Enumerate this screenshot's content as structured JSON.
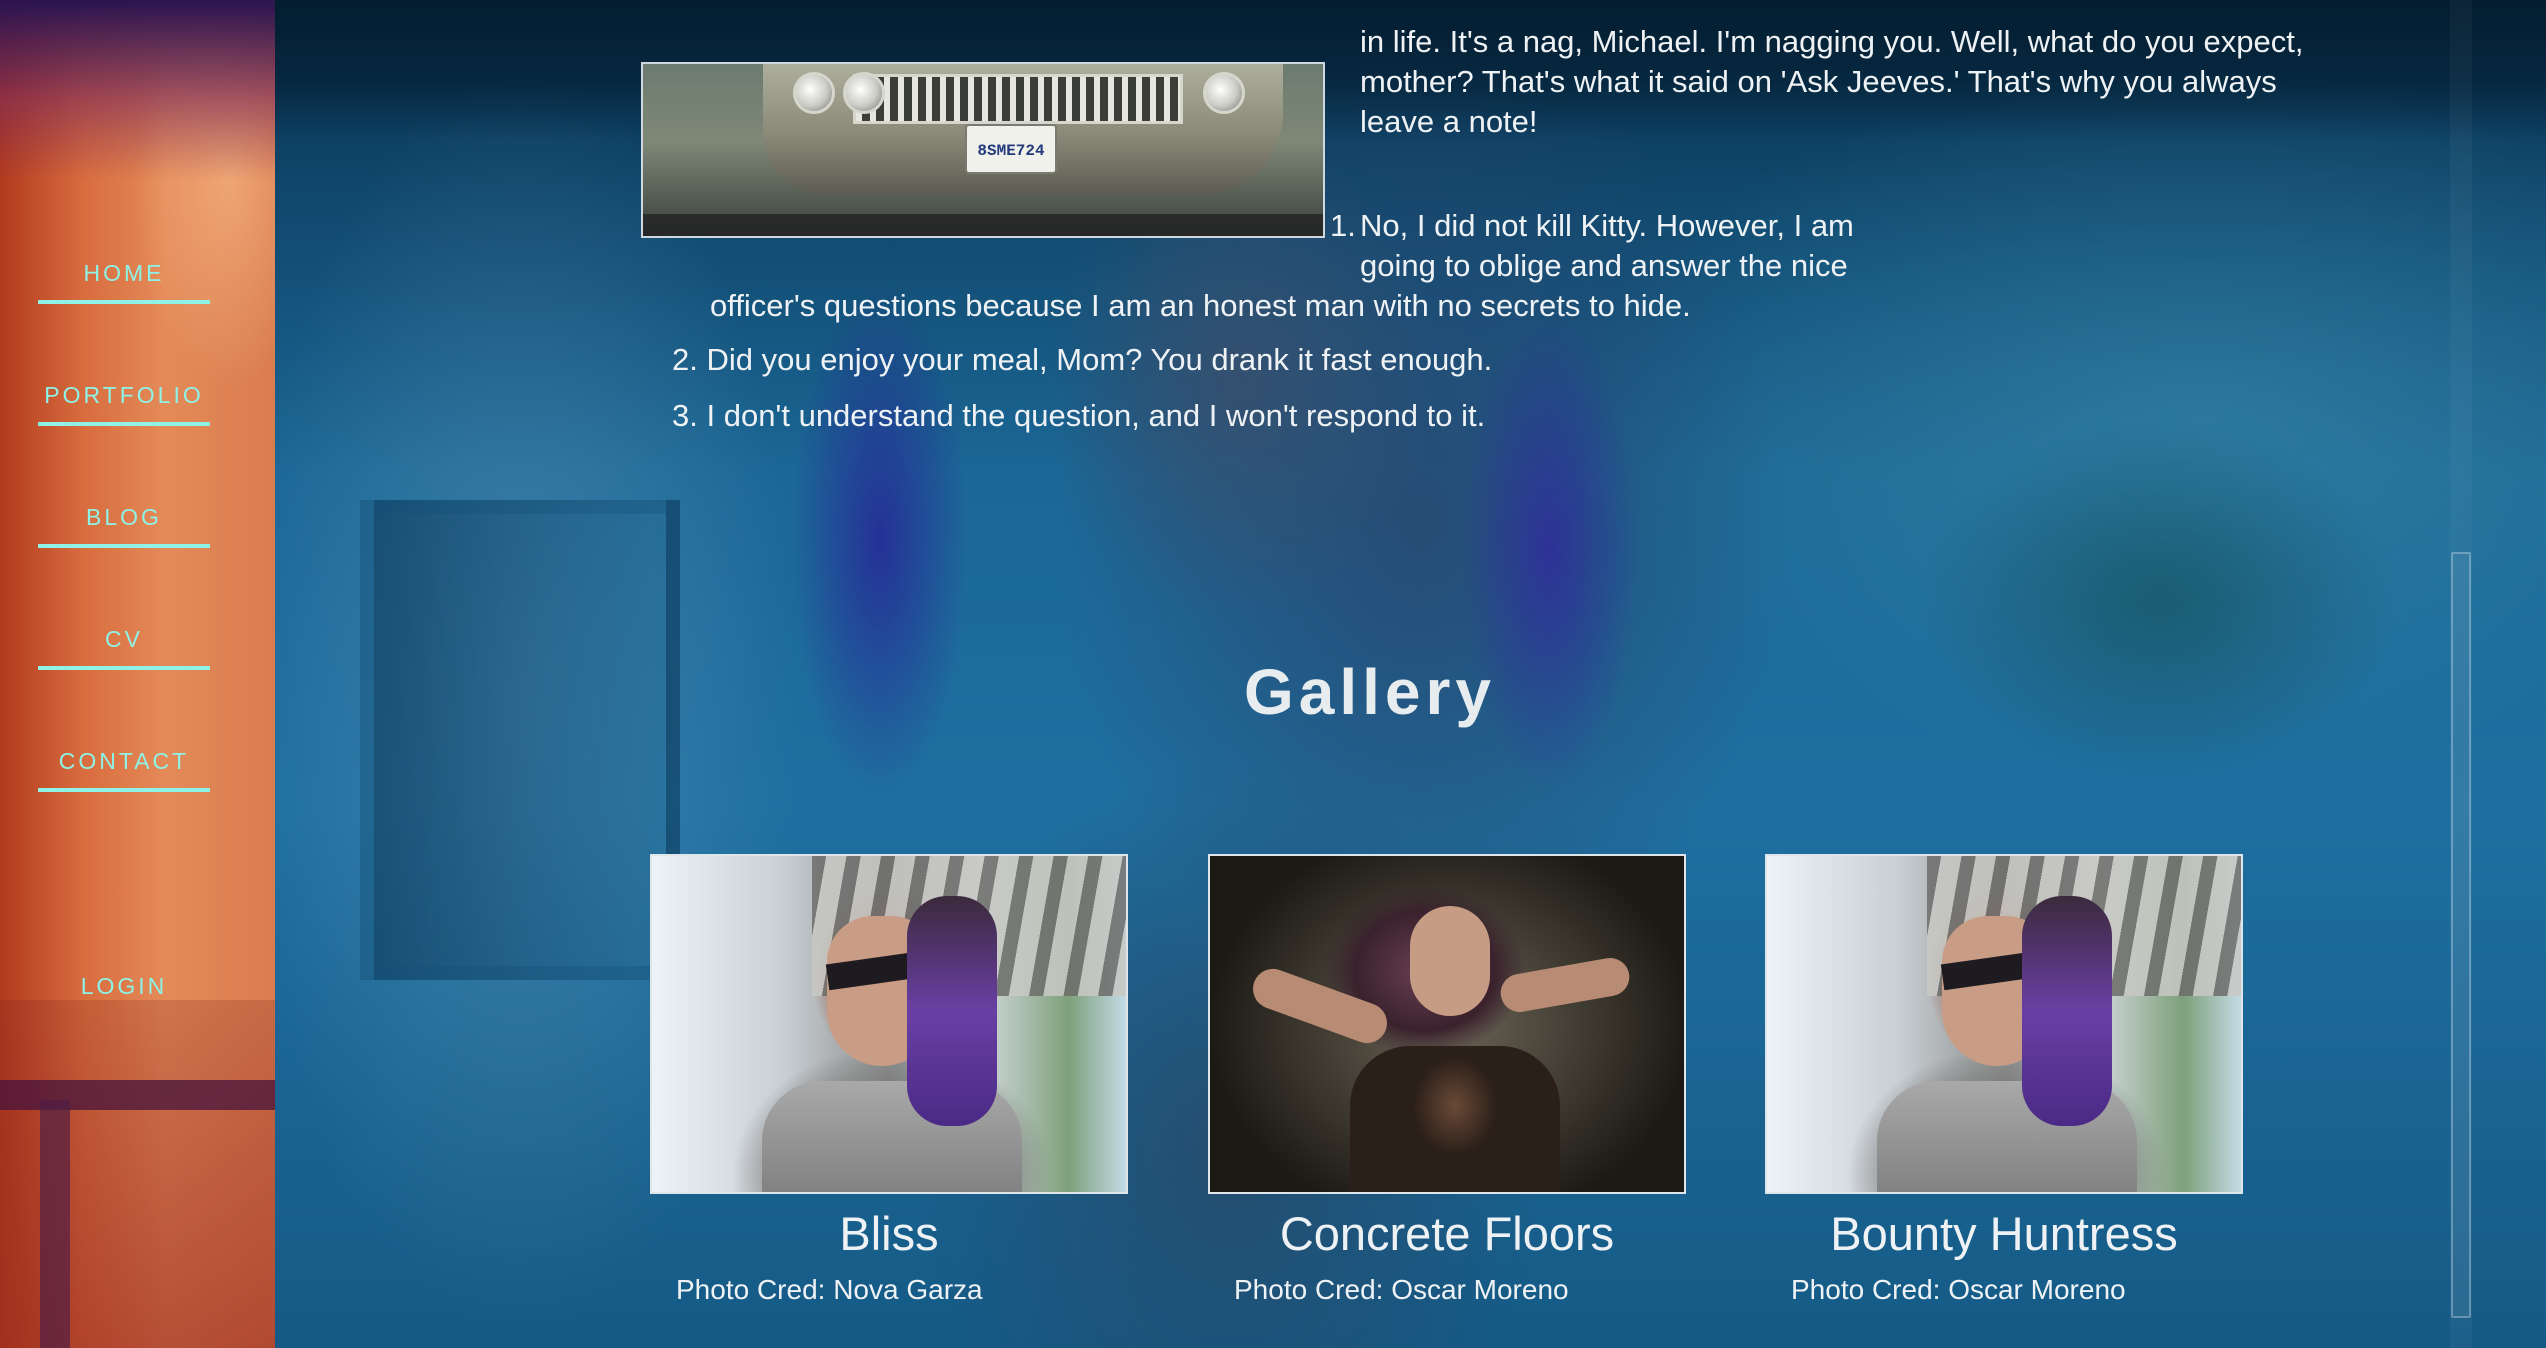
{
  "nav": {
    "items": [
      {
        "label": "HOME"
      },
      {
        "label": "PORTFOLIO"
      },
      {
        "label": "BLOG"
      },
      {
        "label": "CV"
      },
      {
        "label": "CONTACT"
      }
    ],
    "login": "LOGIN"
  },
  "article": {
    "car_plate": "8SME724",
    "paragraph_lines": [
      "in life. It's a nag, Michael. I'm nagging you. Well, what do you expect,",
      "mother? That's what it said on 'Ask Jeeves.' That's why you always",
      "leave a note!"
    ],
    "list": [
      {
        "number": "1.",
        "lines": [
          "No, I did not kill Kitty. However, I am",
          "going to oblige and answer the nice",
          "officer's questions because I am an honest man with no secrets to hide."
        ]
      },
      {
        "number": "2.",
        "text": "Did you enjoy your meal, Mom? You drank it fast enough."
      },
      {
        "number": "3.",
        "text": "I don't understand the question, and I won't respond to it."
      }
    ]
  },
  "gallery": {
    "title": "Gallery",
    "items": [
      {
        "title": "Bliss",
        "credit": "Photo Cred: Nova Garza"
      },
      {
        "title": "Concrete Floors",
        "credit": "Photo Cred: Oscar Moreno"
      },
      {
        "title": "Bounty Huntress",
        "credit": "Photo Cred: Oscar Moreno"
      }
    ]
  },
  "colors": {
    "nav_accent": "#8ef3e6",
    "text": "#eef2f4",
    "overlay": "#1f6fa0"
  }
}
